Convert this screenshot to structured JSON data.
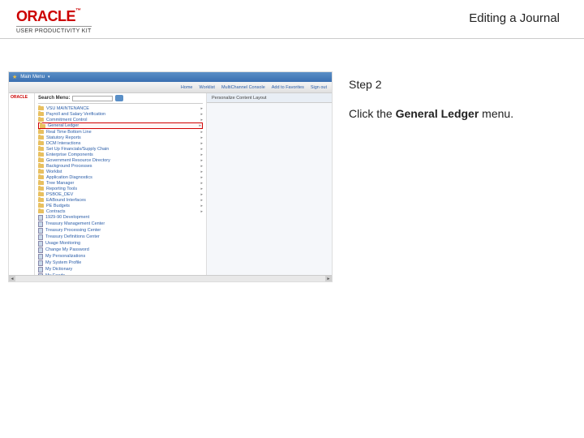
{
  "brand": {
    "logo": "ORACLE",
    "tm": "™",
    "sub": "USER PRODUCTIVITY KIT"
  },
  "page_title": "Editing a Journal",
  "screenshot": {
    "topbar": {
      "home": "Main Menu"
    },
    "nav": {
      "home": "Home",
      "worklist": "Worklist",
      "multichannel": "MultiChannel Console",
      "favorites": "Add to Favorites",
      "signout": "Sign out"
    },
    "mini_logo": "ORACLE",
    "search_label": "Search Menu:",
    "personalize": "Personalize Content   Layout",
    "menu_items": [
      {
        "icon": "folder",
        "label": "VSU MAINTENANCE",
        "arrow": true
      },
      {
        "icon": "folder",
        "label": "Payroll and Salary Verification",
        "arrow": true
      },
      {
        "icon": "folder",
        "label": "Commitment Control",
        "arrow": true
      },
      {
        "icon": "folder",
        "label": "General Ledger",
        "arrow": true,
        "highlighted": true
      },
      {
        "icon": "folder",
        "label": "Real Time Bottom Line",
        "arrow": true
      },
      {
        "icon": "folder",
        "label": "Statutory Reports",
        "arrow": true
      },
      {
        "icon": "folder",
        "label": "DCM Interactions",
        "arrow": true
      },
      {
        "icon": "folder",
        "label": "Set Up Financials/Supply Chain",
        "arrow": true
      },
      {
        "icon": "folder",
        "label": "Enterprise Components",
        "arrow": true
      },
      {
        "icon": "folder",
        "label": "Government Resource Directory",
        "arrow": true
      },
      {
        "icon": "folder",
        "label": "Background Processes",
        "arrow": true
      },
      {
        "icon": "folder",
        "label": "Worklist",
        "arrow": true
      },
      {
        "icon": "folder",
        "label": "Application Diagnostics",
        "arrow": true
      },
      {
        "icon": "folder",
        "label": "Tree Manager",
        "arrow": true
      },
      {
        "icon": "folder",
        "label": "Reporting Tools",
        "arrow": true
      },
      {
        "icon": "folder",
        "label": "PSBOE_DEV",
        "arrow": true
      },
      {
        "icon": "folder",
        "label": "EABound Interfaces",
        "arrow": true
      },
      {
        "icon": "folder",
        "label": "PE Budgets",
        "arrow": true
      },
      {
        "icon": "folder",
        "label": "Contracts",
        "arrow": true
      },
      {
        "icon": "page",
        "label": "1929-90 Development"
      },
      {
        "icon": "page",
        "label": "Treasury Management Center"
      },
      {
        "icon": "page",
        "label": "Treasury Processing Center"
      },
      {
        "icon": "page",
        "label": "Treasury Definitions Center"
      },
      {
        "icon": "page",
        "label": "Usage Monitoring"
      },
      {
        "icon": "page",
        "label": "Change My Password"
      },
      {
        "icon": "page",
        "label": "My Personalizations"
      },
      {
        "icon": "page",
        "label": "My System Profile"
      },
      {
        "icon": "page",
        "label": "My Dictionary"
      },
      {
        "icon": "page",
        "label": "My Feeds"
      }
    ]
  },
  "instructions": {
    "step_label": "Step 2",
    "text_before": "Click the ",
    "bold": "General Ledger",
    "text_after": " menu."
  }
}
